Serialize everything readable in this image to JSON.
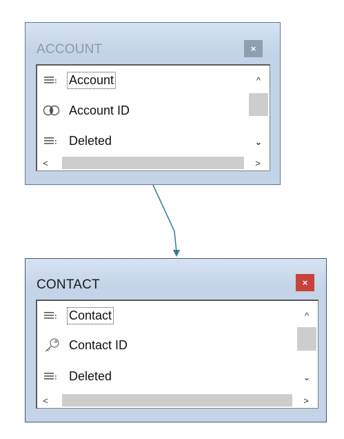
{
  "tables": [
    {
      "name": "ACCOUNT",
      "state": "inactive",
      "close_label": "×",
      "fields": [
        {
          "label": "Account",
          "icon": "field-lines-icon",
          "focused": true
        },
        {
          "label": "Account ID",
          "icon": "linked-rings-icon",
          "focused": false
        },
        {
          "label": "Deleted",
          "icon": "field-lines-icon",
          "focused": false
        }
      ]
    },
    {
      "name": "CONTACT",
      "state": "active",
      "close_label": "×",
      "fields": [
        {
          "label": "Contact",
          "icon": "field-lines-icon",
          "focused": true
        },
        {
          "label": "Contact ID",
          "icon": "key-icon",
          "focused": false
        },
        {
          "label": "Deleted",
          "icon": "field-lines-icon",
          "focused": false
        }
      ]
    }
  ],
  "scroll_glyphs": {
    "up": "^",
    "down": "⌄",
    "left": "<",
    "right": ">"
  },
  "colors": {
    "connector": "#2e7d8c",
    "close_active": "#c8413a",
    "close_inactive": "#8f9fb2",
    "header_bg": "#c3d4e8"
  }
}
